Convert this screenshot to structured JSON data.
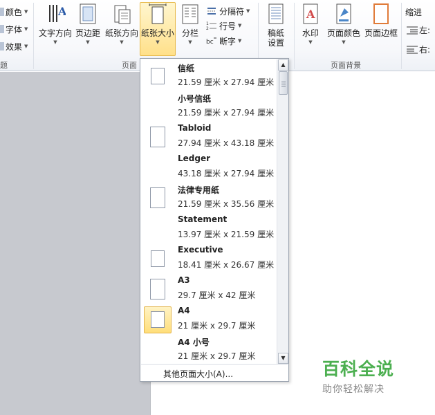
{
  "ribbon": {
    "theme_group": {
      "items": [
        {
          "label": "颜色",
          "icon": "theme-colors-icon"
        },
        {
          "label": "字体",
          "icon": "theme-fonts-icon"
        },
        {
          "label": "效果",
          "icon": "theme-effects-icon"
        }
      ],
      "group_label": "题"
    },
    "page_setup": {
      "buttons": [
        {
          "label": "文字方向",
          "icon": "text-direction-icon"
        },
        {
          "label": "页边距",
          "icon": "margins-icon"
        },
        {
          "label": "纸张方向",
          "icon": "orientation-icon"
        },
        {
          "label": "纸张大小",
          "icon": "paper-size-icon",
          "active": true
        },
        {
          "label": "分栏",
          "icon": "columns-icon"
        }
      ],
      "small_buttons": [
        {
          "label": "分隔符",
          "icon": "breaks-icon"
        },
        {
          "label": "行号",
          "icon": "line-numbers-icon"
        },
        {
          "label": "断字",
          "icon": "hyphenation-icon"
        }
      ],
      "group_label": "页面"
    },
    "draft": {
      "label": "稿纸\n设置",
      "icon": "draft-paper-icon"
    },
    "page_background": {
      "buttons": [
        {
          "label": "水印",
          "icon": "watermark-icon"
        },
        {
          "label": "页面颜色",
          "icon": "page-color-icon"
        },
        {
          "label": "页面边框",
          "icon": "page-borders-icon"
        }
      ],
      "group_label": "页面背景"
    },
    "paragraph": {
      "title": "缩进",
      "left_label": "左:",
      "right_label": "右:"
    }
  },
  "paper_size_menu": {
    "items": [
      {
        "name": "信纸",
        "dims": "21.59 厘米 x 27.94 厘米",
        "shape": "portrait"
      },
      {
        "name": "小号信纸",
        "dims": "21.59 厘米 x 27.94 厘米",
        "shape": "none"
      },
      {
        "name": "Tabloid",
        "dims": "27.94 厘米 x 43.18 厘米",
        "shape": "tall"
      },
      {
        "name": "Ledger",
        "dims": "43.18 厘米 x 27.94 厘米",
        "shape": "none"
      },
      {
        "name": "法律专用纸",
        "dims": "21.59 厘米 x 35.56 厘米",
        "shape": "tall"
      },
      {
        "name": "Statement",
        "dims": "13.97 厘米 x 21.59 厘米",
        "shape": "none"
      },
      {
        "name": "Executive",
        "dims": "18.41 厘米 x 26.67 厘米",
        "shape": "portrait"
      },
      {
        "name": "A3",
        "dims": "29.7 厘米 x 42 厘米",
        "shape": "tall"
      },
      {
        "name": "A4",
        "dims": "21 厘米 x 29.7 厘米",
        "shape": "portrait",
        "selected": true
      },
      {
        "name": "A4 小号",
        "dims": "21 厘米 x 29.7 厘米",
        "shape": "none"
      }
    ],
    "more_label": "其他页面大小(A)...",
    "scroll_up": "▲",
    "scroll_down": "▼"
  },
  "watermark": {
    "title": "百科全说",
    "subtitle": "助你轻松解决"
  },
  "colors": {
    "active_button": "#ffe08a",
    "watermark_green": "#4caf50"
  }
}
